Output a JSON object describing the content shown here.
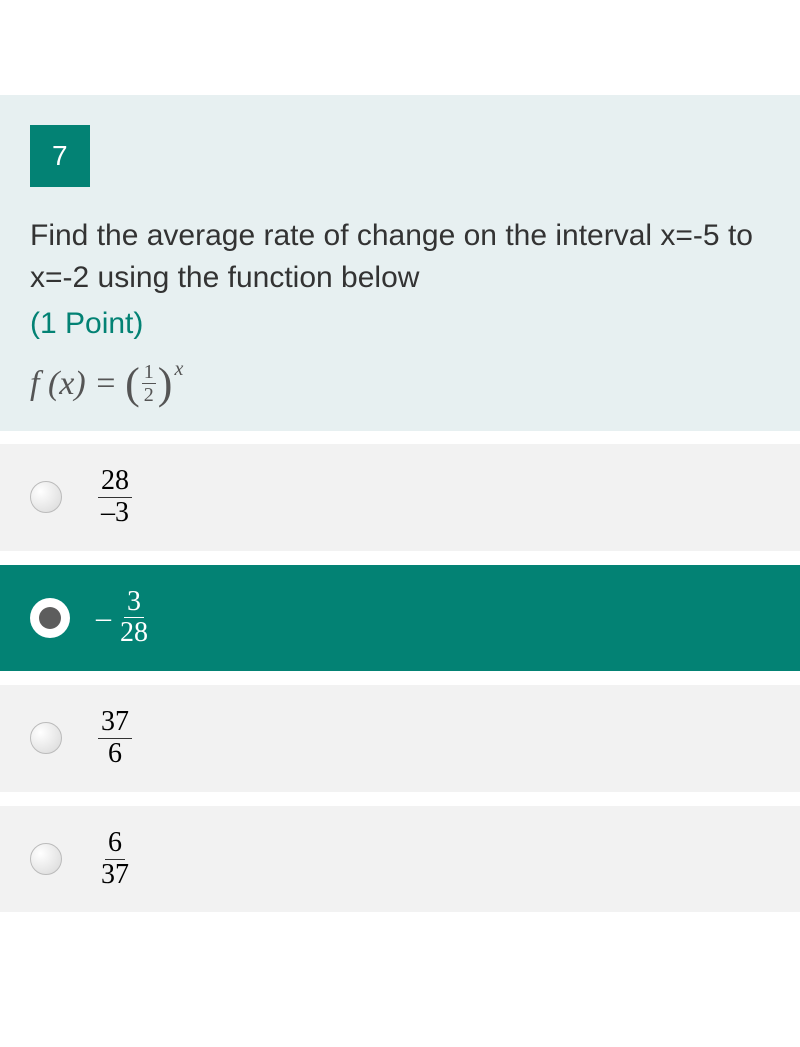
{
  "question": {
    "number": "7",
    "text": "Find the average rate of change on the interval x=-5 to x=-2 using the function below",
    "points": "(1 Point)",
    "formula": {
      "prefix": "f (x) = ",
      "frac_num": "1",
      "frac_den": "2",
      "exponent": "x"
    }
  },
  "options": [
    {
      "neg": "",
      "num": "28",
      "den": "–3",
      "selected": false
    },
    {
      "neg": "–",
      "num": "3",
      "den": "28",
      "selected": true
    },
    {
      "neg": "",
      "num": "37",
      "den": "6",
      "selected": false
    },
    {
      "neg": "",
      "num": "6",
      "den": "37",
      "selected": false
    }
  ]
}
